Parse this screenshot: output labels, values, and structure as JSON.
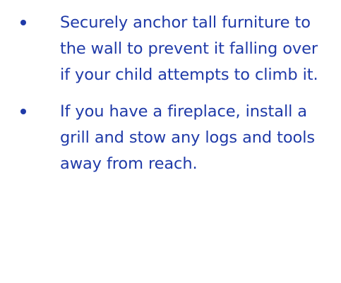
{
  "tips": [
    {
      "text": "Securely anchor tall furniture to the wall to prevent it falling over if your child attempts to climb it."
    },
    {
      "text": "If you have a fireplace, install a grill and stow any logs and tools away from reach."
    }
  ],
  "colors": {
    "text": "#1f3aa8",
    "bullet": "#1f3aa8",
    "background": "#ffffff"
  }
}
